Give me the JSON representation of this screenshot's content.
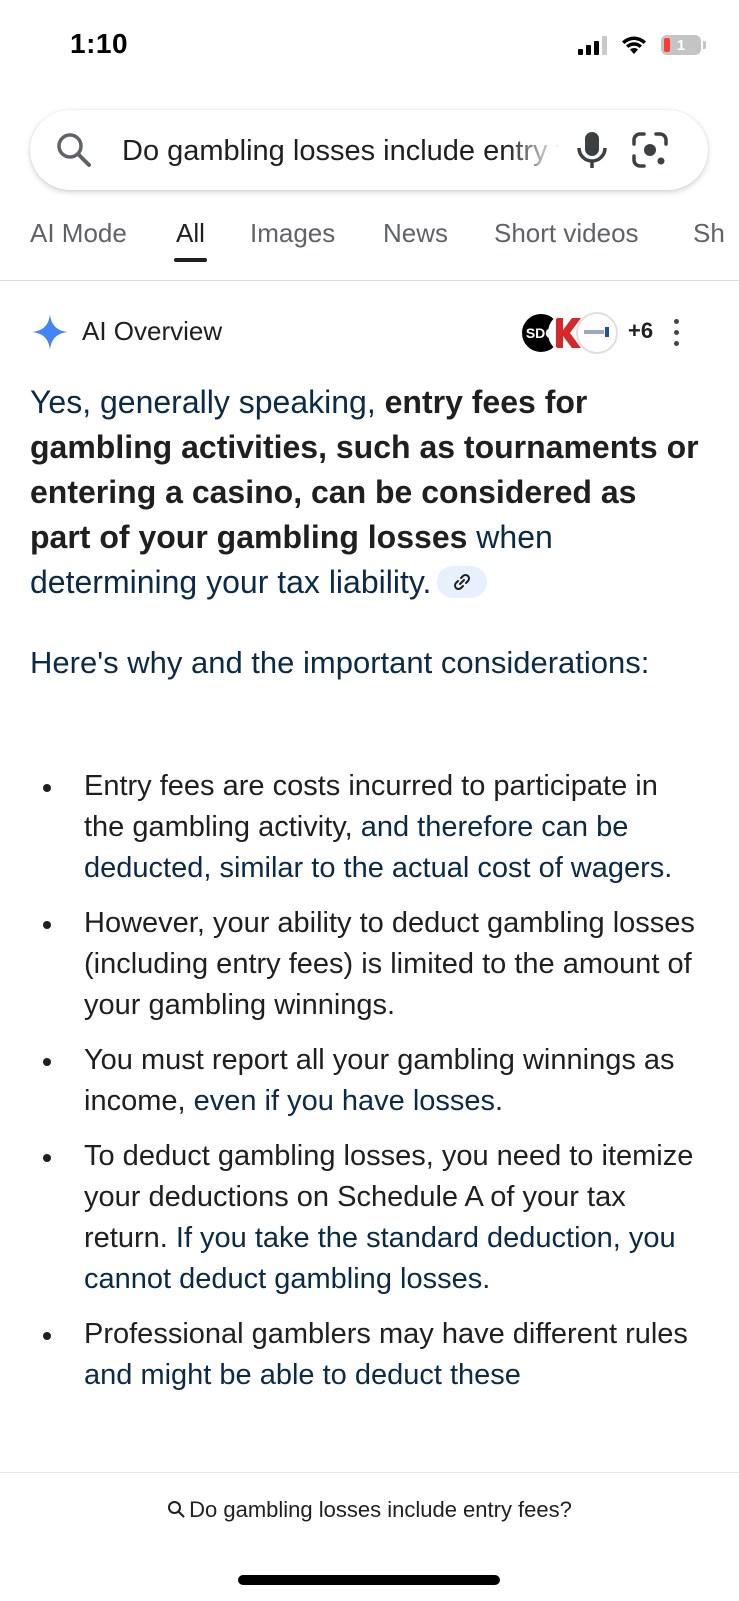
{
  "status_bar": {
    "time": "1:10",
    "battery_level": "1",
    "signal_bars_active": 3,
    "signal_bars_total": 4
  },
  "search": {
    "query": "Do gambling losses include entry fees?"
  },
  "tabs": [
    {
      "label": "AI Mode",
      "active": false
    },
    {
      "label": "All",
      "active": true
    },
    {
      "label": "Images",
      "active": false
    },
    {
      "label": "News",
      "active": false
    },
    {
      "label": "Short videos",
      "active": false
    },
    {
      "label": "Sh",
      "active": false
    }
  ],
  "ai_overview": {
    "title": "AI Overview",
    "sources": {
      "first_label": "SDO",
      "more_count": "+6"
    },
    "answer": {
      "part1": "Yes, generally speaking, ",
      "part2_bold": "entry fees for gambling activities, such as tournaments or entering a casino, can be considered as part of your gambling losses",
      "part3": " when determining your tax liability."
    },
    "subheading": "Here's why and the important considerations:",
    "bullets": [
      {
        "bold": "Entry fees are costs incurred to participate in the gambling activity,",
        "rest": " and therefore can be deducted, similar to the actual cost of wagers."
      },
      {
        "bold": "However, your ability to deduct gambling losses (including entry fees) is limited to the amount of your gambling winnings.",
        "rest": ""
      },
      {
        "bold": "You must report all your gambling winnings as income,",
        "rest": " even if you have losses."
      },
      {
        "bold": "To deduct gambling losses, you need to itemize your deductions on Schedule A of your tax return.",
        "rest": " If you take the standard deduction, you cannot deduct gambling losses."
      },
      {
        "bold": "Professional gamblers may have different rules",
        "rest": " and might be able to deduct these"
      }
    ]
  },
  "bottom_bar": {
    "query": "Do gambling losses include entry fees?"
  },
  "colors": {
    "accent_blue": "#4285f4",
    "text_dark": "#1f1f1f",
    "text_answer": "#0b2a4a",
    "tab_inactive": "#5f6368"
  }
}
